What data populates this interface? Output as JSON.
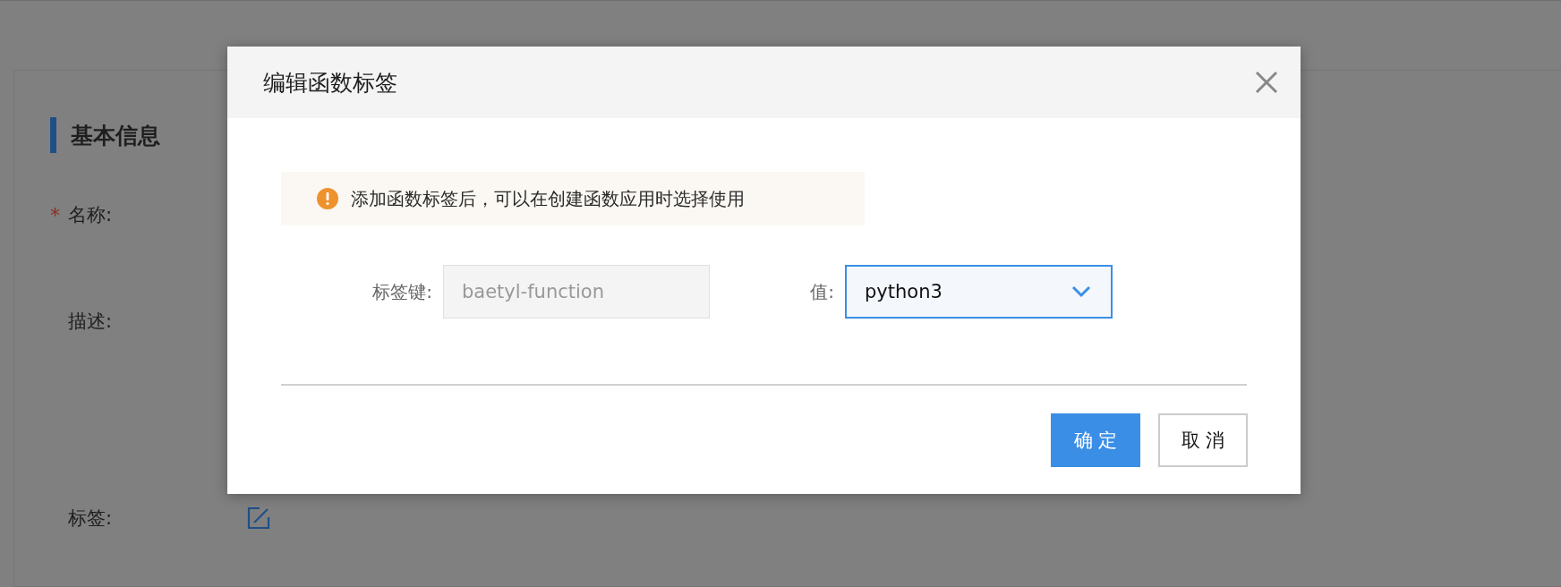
{
  "page": {
    "section_title": "基本信息",
    "fields": [
      {
        "required_mark": "*",
        "label": "名称:",
        "kind": "text"
      },
      {
        "label": "描述:",
        "kind": "text"
      },
      {
        "label": "标签:",
        "kind": "edit"
      }
    ]
  },
  "dialog": {
    "title": "编辑函数标签",
    "notice": "添加函数标签后，可以在创建函数应用时选择使用",
    "tag_key": {
      "label": "标签键:",
      "value": "baetyl-function",
      "disabled": true
    },
    "tag_value": {
      "label": "值:",
      "value": "python3",
      "focused": true
    },
    "buttons": [
      {
        "label": "确 定",
        "kind": "primary"
      },
      {
        "label": "取 消",
        "kind": "default"
      }
    ]
  }
}
